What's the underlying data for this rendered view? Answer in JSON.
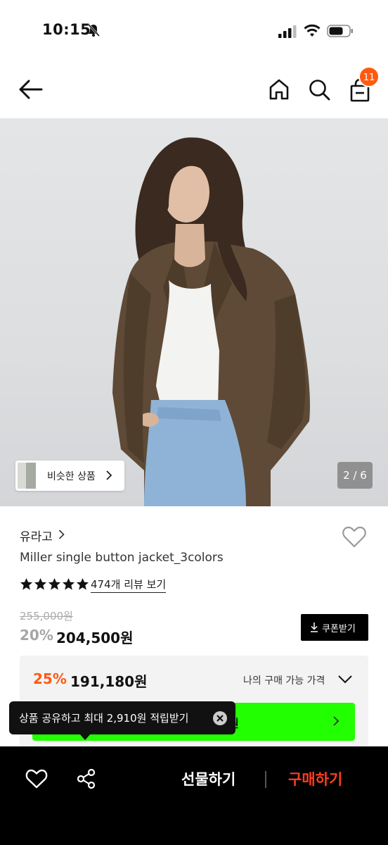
{
  "status_bar": {
    "time": "10:15",
    "icons": [
      "bell-muted-icon",
      "signal-icon",
      "wifi-icon",
      "battery-icon"
    ]
  },
  "nav": {
    "icons": [
      "back-arrow-icon",
      "home-icon",
      "search-icon",
      "shopping-bag-icon"
    ],
    "cart_count": "11"
  },
  "gallery": {
    "similar_label": "비슷한 상품",
    "page_counter": "2 / 6"
  },
  "product": {
    "brand": "유라고",
    "name": "Miller single button jacket_3colors",
    "rating_stars": 5,
    "review_link": "474개 리뷰 보기",
    "original_price": "255,000원",
    "discount_rate": "20%",
    "sale_price": "204,500원",
    "coupon_label": "쿠폰받기"
  },
  "best_price": {
    "rate": "25%",
    "price": "191,180원",
    "label": "나의 구매 가능 가격",
    "button_partial": "0원"
  },
  "tooltip": {
    "text": "상품 공유하고 최대 2,910원 적립받기"
  },
  "bottom_bar": {
    "gift_label": "선물하기",
    "buy_label": "구매하기"
  },
  "colors": {
    "accent_orange": "#ff5a12",
    "buy_red": "#ff3d22",
    "green_button": "#22ff00",
    "bottom_bar": "#000000"
  }
}
